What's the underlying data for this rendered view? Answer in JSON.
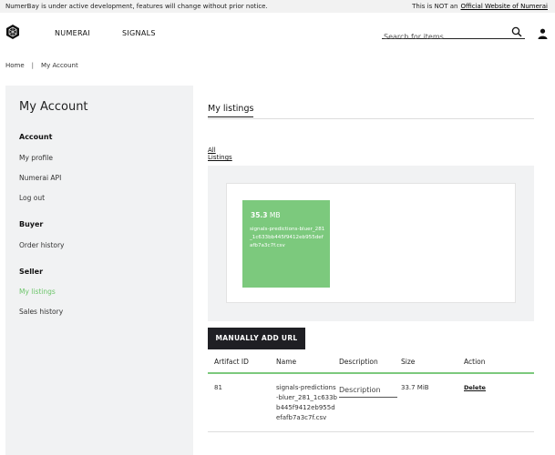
{
  "topbar": {
    "notice": "NumerBay is under active development, features will change without prior notice.",
    "disclaimer": "This is NOT an",
    "official_link": "Official Website of Numerai"
  },
  "header": {
    "nav": [
      "NUMERAI",
      "SIGNALS"
    ],
    "search_placeholder": "Search for items"
  },
  "breadcrumb": {
    "home": "Home",
    "sep": "|",
    "current": "My Account"
  },
  "sidebar": {
    "title": "My Account",
    "sections": {
      "account": "Account",
      "buyer": "Buyer",
      "seller": "Seller"
    },
    "items": {
      "profile": "My profile",
      "api": "Numerai API",
      "logout": "Log out",
      "order_history": "Order history",
      "my_listings": "My listings",
      "sales_history": "Sales history"
    },
    "active_color": "#6cc56a"
  },
  "main": {
    "tab": "My listings",
    "all_listings": "All Listings",
    "card": {
      "size_value": "35.3",
      "size_unit": "MB",
      "filename": "signals-predictions-bluer_281_1c633bb445f9412eb955defafb7a3c7f.csv",
      "color": "#7cc97d"
    },
    "add_url_button": "MANUALLY ADD URL",
    "table": {
      "headers": [
        "Artifact ID",
        "Name",
        "Description",
        "Size",
        "Action"
      ],
      "rows": [
        {
          "id": "81",
          "name": "signals-predictions-bluer_281_1c633bb445f9412eb955defafb7a3c7f.csv",
          "description_placeholder": "Description",
          "size": "33.7 MiB",
          "action": "Delete"
        }
      ]
    }
  }
}
